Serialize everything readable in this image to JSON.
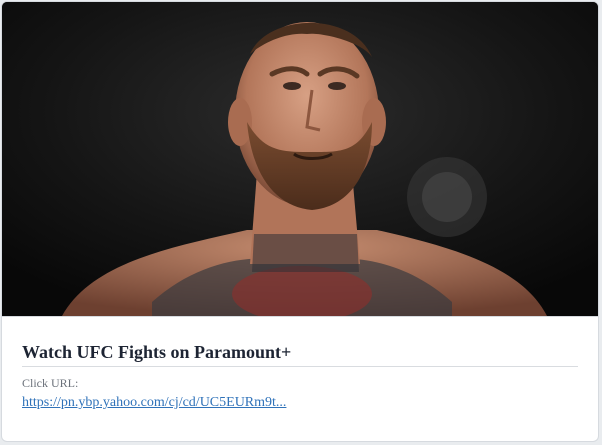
{
  "card": {
    "image": {
      "description_alt": "Photo"
    },
    "title": "Watch UFC Fights on Paramount+",
    "click_label": "Click URL:",
    "url_text": "https://pn.ybp.yahoo.com/cj/cd/UC5EURm9t..."
  }
}
